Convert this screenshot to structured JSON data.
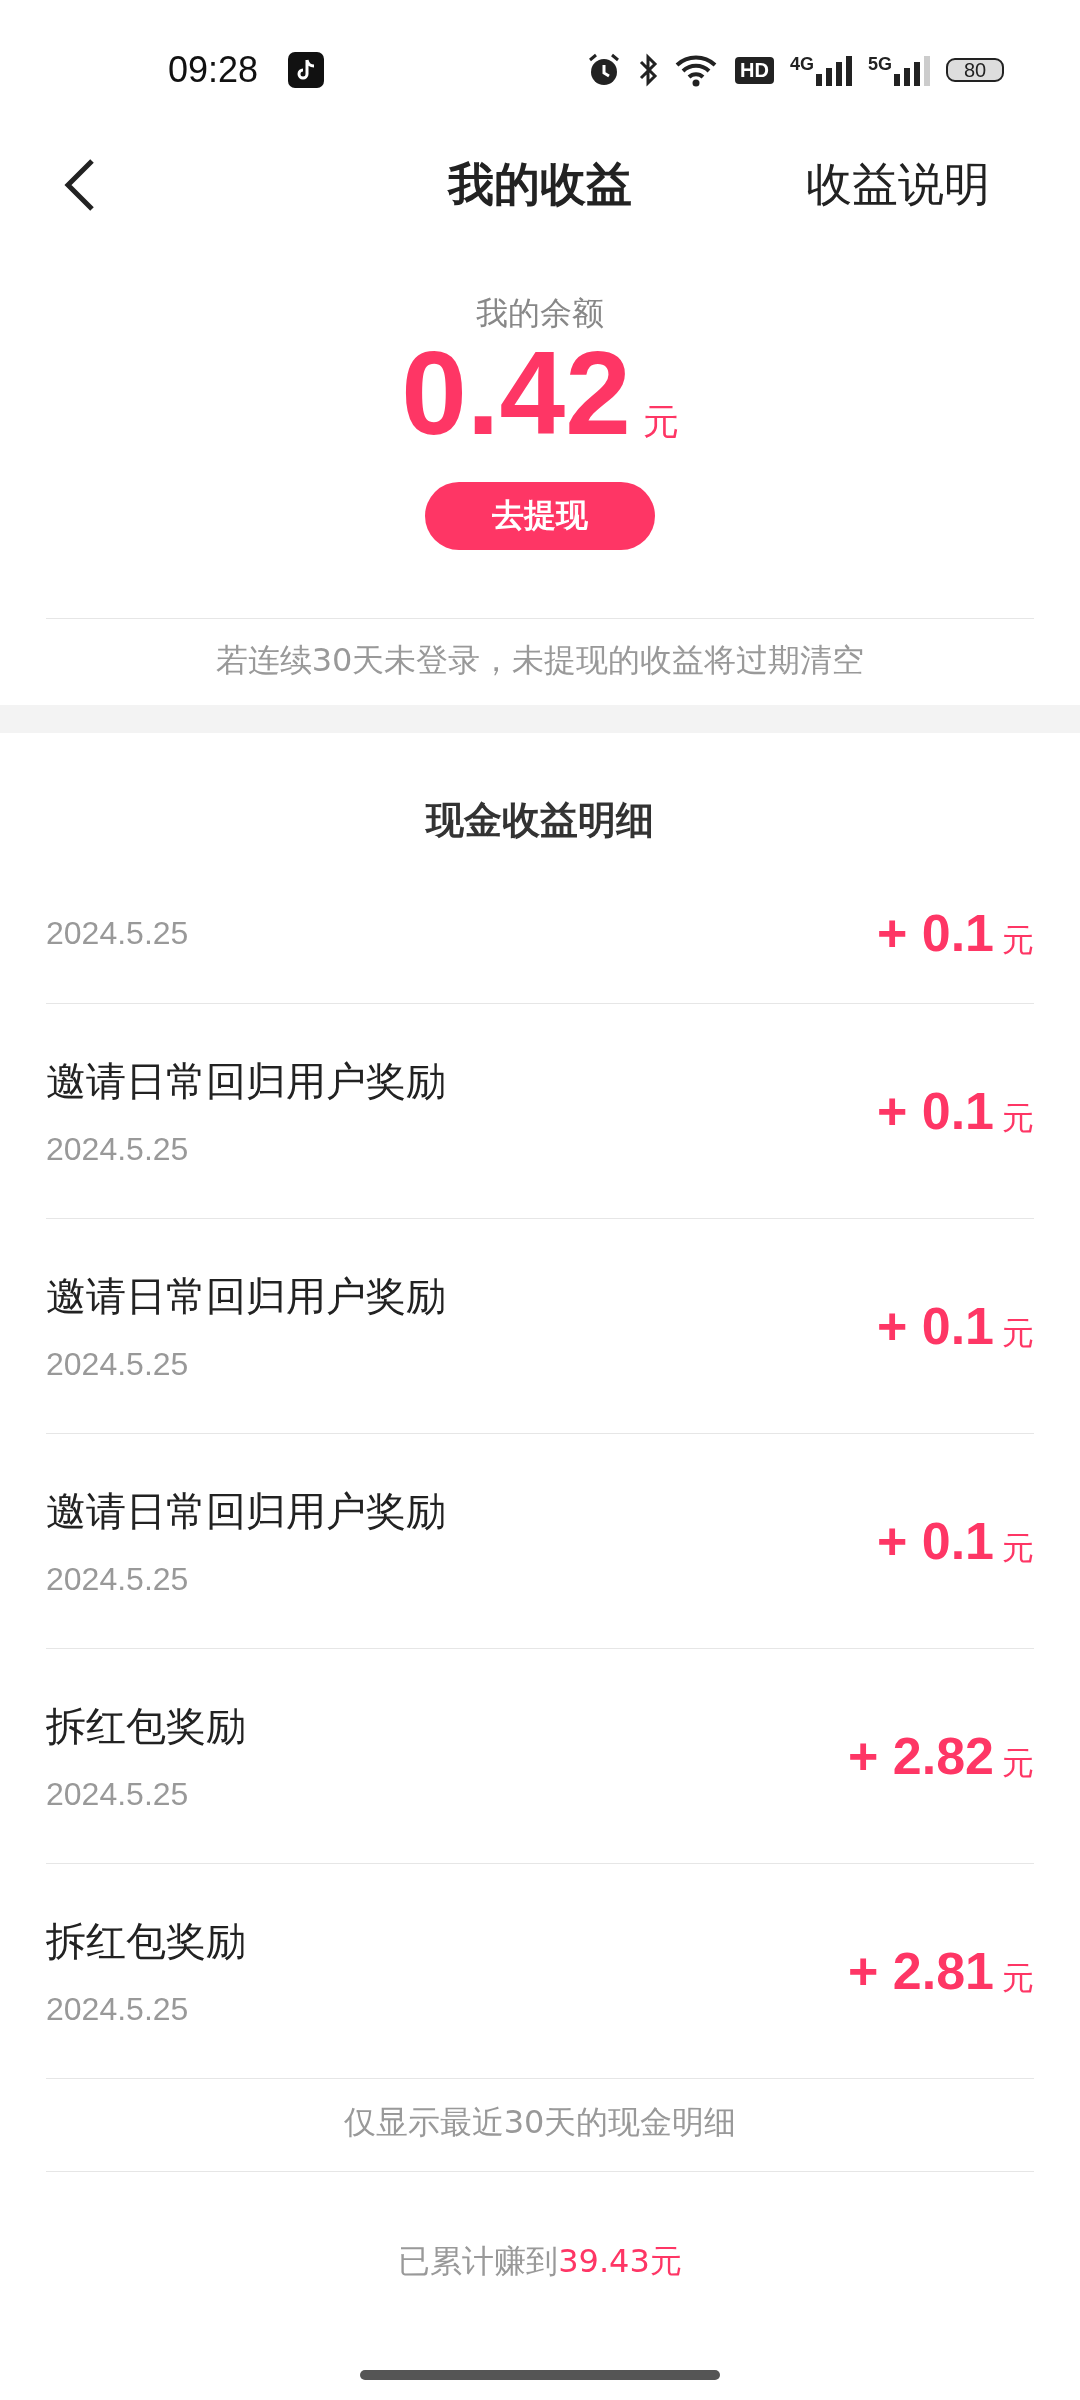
{
  "status_bar": {
    "time": "09:28",
    "hd": "HD",
    "net1": "4G",
    "net2": "5G",
    "battery": "80"
  },
  "header": {
    "title": "我的收益",
    "action": "收益说明"
  },
  "balance": {
    "label": "我的余额",
    "amount": "0.42",
    "unit": "元",
    "button": "去提现",
    "notice": "若连续30天未登录，未提现的收益将过期清空"
  },
  "details": {
    "title": "现金收益明细",
    "rows": [
      {
        "date": "2024.5.25",
        "amount": "+ 0.1",
        "unit": "元"
      },
      {
        "title": "邀请日常回归用户奖励",
        "date": "2024.5.25",
        "amount": "+ 0.1",
        "unit": "元"
      },
      {
        "title": "邀请日常回归用户奖励",
        "date": "2024.5.25",
        "amount": "+ 0.1",
        "unit": "元"
      },
      {
        "title": "邀请日常回归用户奖励",
        "date": "2024.5.25",
        "amount": "+ 0.1",
        "unit": "元"
      },
      {
        "title": "拆红包奖励",
        "date": "2024.5.25",
        "amount": "+ 2.82",
        "unit": "元"
      },
      {
        "title": "拆红包奖励",
        "date": "2024.5.25",
        "amount": "+ 2.81",
        "unit": "元"
      }
    ],
    "footnote": "仅显示最近30天的现金明细"
  },
  "total": {
    "label": "已累计赚到",
    "value": "39.43元"
  }
}
